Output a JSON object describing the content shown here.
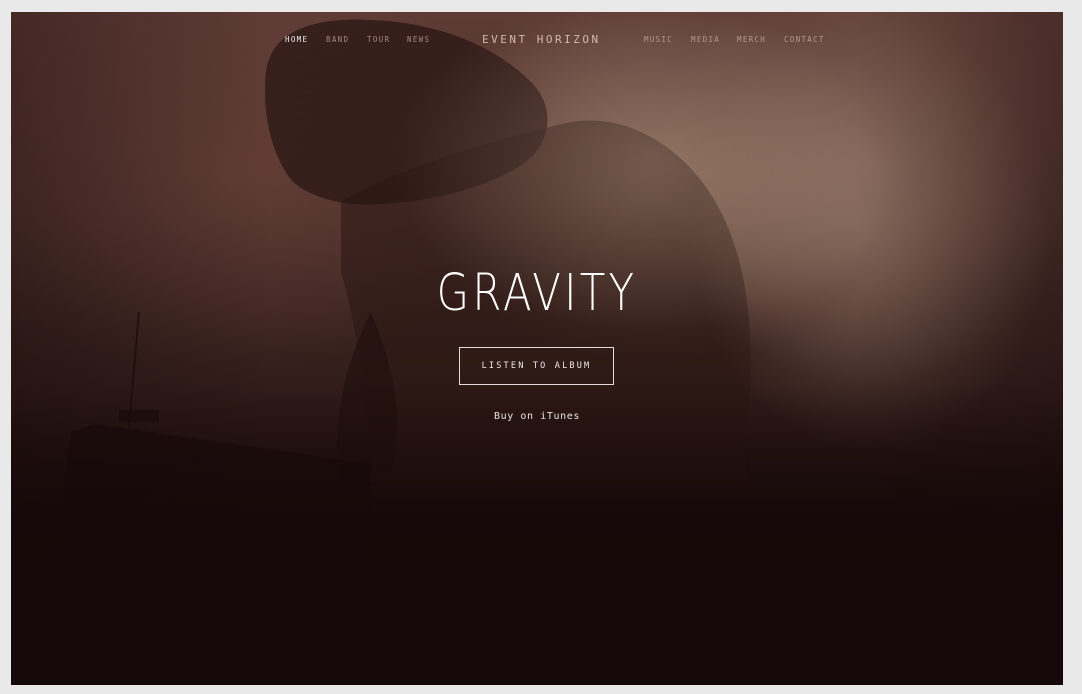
{
  "nav": {
    "left": [
      {
        "label": "HOME",
        "active": true
      },
      {
        "label": "BAND",
        "active": false
      },
      {
        "label": "TOUR",
        "active": false
      },
      {
        "label": "NEWS",
        "active": false
      }
    ],
    "brand": "EVENT HORIZON",
    "right": [
      {
        "label": "MUSIC",
        "active": false
      },
      {
        "label": "MEDIA",
        "active": false
      },
      {
        "label": "MERCH",
        "active": false
      },
      {
        "label": "CONTACT",
        "active": false
      }
    ]
  },
  "hero": {
    "title": "GRAVITY",
    "cta_label": "LISTEN TO ALBUM",
    "secondary_link": "Buy on iTunes"
  },
  "colors": {
    "page_bg": "#e9e9e9",
    "hero_dark": "#140808",
    "hero_warm": "#5e3b35",
    "text": "#ffffff"
  }
}
